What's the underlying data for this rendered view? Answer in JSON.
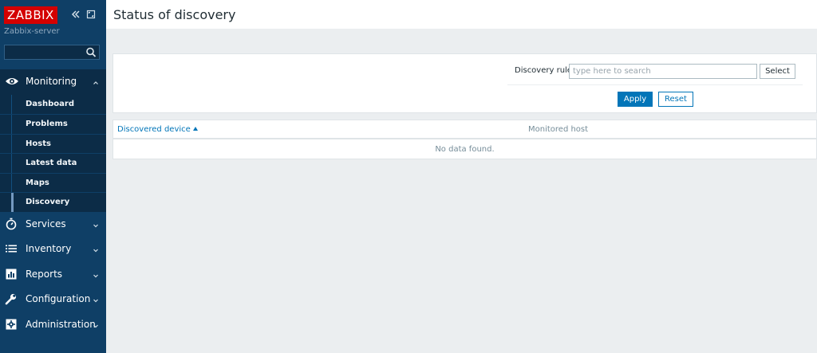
{
  "brand": {
    "logo": "ZABBIX",
    "server": "Zabbix-server"
  },
  "sidebar": {
    "search": {
      "value": "",
      "placeholder": ""
    },
    "menu": [
      {
        "label": "Monitoring",
        "icon": "eye-icon",
        "active": true
      },
      {
        "label": "Services",
        "icon": "stopwatch-icon"
      },
      {
        "label": "Inventory",
        "icon": "list-icon"
      },
      {
        "label": "Reports",
        "icon": "bar-chart-icon"
      },
      {
        "label": "Configuration",
        "icon": "wrench-icon"
      },
      {
        "label": "Administration",
        "icon": "gear-icon"
      }
    ],
    "submenu": [
      {
        "label": "Dashboard"
      },
      {
        "label": "Problems"
      },
      {
        "label": "Hosts"
      },
      {
        "label": "Latest data"
      },
      {
        "label": "Maps"
      },
      {
        "label": "Discovery",
        "selected": true
      }
    ]
  },
  "page": {
    "title": "Status of discovery"
  },
  "filter": {
    "discovery_rule_label": "Discovery rule",
    "discovery_rule_placeholder": "type here to search",
    "select_label": "Select",
    "apply_label": "Apply",
    "reset_label": "Reset"
  },
  "table": {
    "columns": [
      "Discovered device",
      "Monitored host"
    ],
    "empty_text": "No data found."
  },
  "colors": {
    "sidebar_bg": "#0f3f66",
    "sidebar_active_bg": "#0c2c47",
    "logo_bg": "#d40000",
    "accent": "#0275b8",
    "page_bg": "#ebeef0"
  }
}
